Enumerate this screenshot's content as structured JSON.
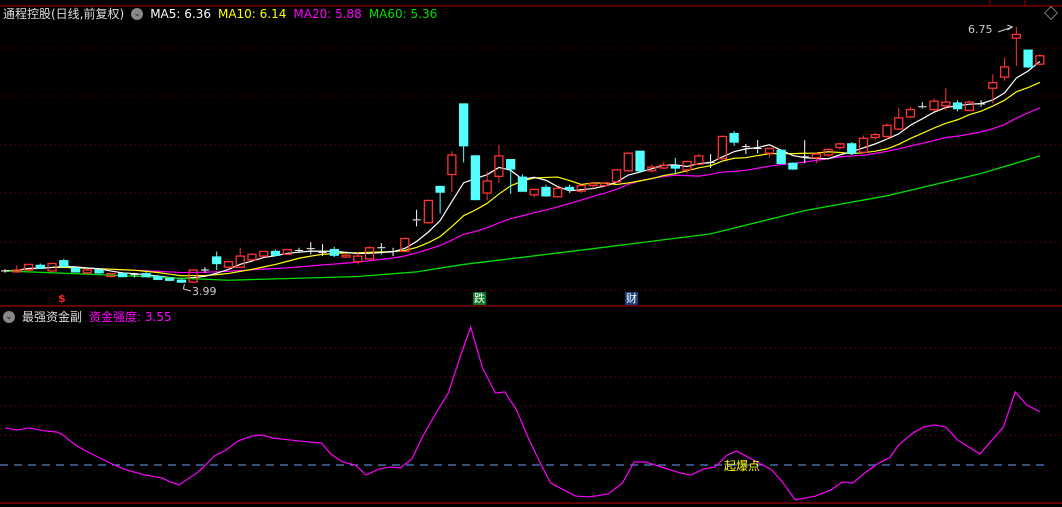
{
  "header": {
    "title": "通程控股(日线,前复权)",
    "ma5_label": "MA5: 6.36",
    "ma10_label": "MA10: 6.14",
    "ma20_label": "MA20: 5.88",
    "ma60_label": "MA60: 5.36"
  },
  "indicator_header": {
    "title": "最强资金副",
    "value_label": "资金强度: 3.55"
  },
  "annotations": {
    "high_label": "6.75",
    "low_label": "3.99",
    "trigger_label": "起爆点",
    "marker_dollar": "$",
    "marker_drop": "跌",
    "marker_finance": "财"
  },
  "colors": {
    "up": "#ff3232",
    "down": "#54ffff",
    "flat": "#ffffff",
    "ma5": "#ffffff",
    "ma10": "#ffff00",
    "ma20": "#ff00ff",
    "ma60": "#00e000",
    "indicator": "#ff00ff",
    "baseline": "#6f9fff",
    "grid": "#8b0000"
  },
  "chart_data": [
    {
      "type": "candlestick",
      "title": "通程控股(日线,前复权)",
      "price_range": [
        3.99,
        6.75
      ],
      "ohlc": [
        [
          4.12,
          4.14,
          4.1,
          4.12
        ],
        [
          4.11,
          4.18,
          4.1,
          4.13
        ],
        [
          4.13,
          4.2,
          4.12,
          4.19
        ],
        [
          4.18,
          4.2,
          4.14,
          4.15
        ],
        [
          4.12,
          4.21,
          4.11,
          4.2
        ],
        [
          4.23,
          4.25,
          4.16,
          4.17
        ],
        [
          4.15,
          4.16,
          4.11,
          4.11
        ],
        [
          4.1,
          4.14,
          4.09,
          4.13
        ],
        [
          4.13,
          4.14,
          4.09,
          4.1
        ],
        [
          4.06,
          4.1,
          4.05,
          4.09
        ],
        [
          4.09,
          4.11,
          4.05,
          4.06
        ],
        [
          4.08,
          4.1,
          4.05,
          4.08
        ],
        [
          4.09,
          4.11,
          4.05,
          4.06
        ],
        [
          4.06,
          4.08,
          4.02,
          4.03
        ],
        [
          4.04,
          4.05,
          4.01,
          4.02
        ],
        [
          4.02,
          4.03,
          3.99,
          4.0
        ],
        [
          4.0,
          4.14,
          3.99,
          4.13
        ],
        [
          4.13,
          4.16,
          4.1,
          4.13
        ],
        [
          4.27,
          4.33,
          4.13,
          4.2
        ],
        [
          4.16,
          4.23,
          4.15,
          4.22
        ],
        [
          4.16,
          4.37,
          4.15,
          4.28
        ],
        [
          4.24,
          4.31,
          4.23,
          4.3
        ],
        [
          4.28,
          4.34,
          4.27,
          4.33
        ],
        [
          4.33,
          4.35,
          4.28,
          4.29
        ],
        [
          4.3,
          4.36,
          4.29,
          4.35
        ],
        [
          4.34,
          4.37,
          4.32,
          4.34
        ],
        [
          4.36,
          4.43,
          4.3,
          4.36
        ],
        [
          4.32,
          4.41,
          4.28,
          4.32
        ],
        [
          4.35,
          4.38,
          4.27,
          4.29
        ],
        [
          4.27,
          4.3,
          4.26,
          4.29
        ],
        [
          4.22,
          4.32,
          4.19,
          4.28
        ],
        [
          4.25,
          4.39,
          4.24,
          4.37
        ],
        [
          4.37,
          4.42,
          4.3,
          4.36
        ],
        [
          4.33,
          4.37,
          4.28,
          4.33
        ],
        [
          4.33,
          4.48,
          4.32,
          4.47
        ],
        [
          4.67,
          4.78,
          4.6,
          4.66
        ],
        [
          4.64,
          4.89,
          4.63,
          4.88
        ],
        [
          5.03,
          5.04,
          4.74,
          4.97
        ],
        [
          5.16,
          5.41,
          4.97,
          5.37
        ],
        [
          5.92,
          5.92,
          5.29,
          5.47
        ],
        [
          5.36,
          5.36,
          4.9,
          4.89
        ],
        [
          4.96,
          5.19,
          4.88,
          5.09
        ],
        [
          5.14,
          5.48,
          5.07,
          5.36
        ],
        [
          5.32,
          5.32,
          4.95,
          5.22
        ],
        [
          5.13,
          5.16,
          4.98,
          4.98
        ],
        [
          4.94,
          5.0,
          4.91,
          5.0
        ],
        [
          5.02,
          5.05,
          4.92,
          4.93
        ],
        [
          4.92,
          5.01,
          4.91,
          5.01
        ],
        [
          5.02,
          5.05,
          4.96,
          5.0
        ],
        [
          4.98,
          5.05,
          4.96,
          5.04
        ],
        [
          5.04,
          5.07,
          5.01,
          5.06
        ],
        [
          5.04,
          5.08,
          5.02,
          5.07
        ],
        [
          5.08,
          5.21,
          5.07,
          5.21
        ],
        [
          5.2,
          5.4,
          5.19,
          5.39
        ],
        [
          5.41,
          5.41,
          5.19,
          5.2
        ],
        [
          5.2,
          5.27,
          5.18,
          5.24
        ],
        [
          5.23,
          5.29,
          5.22,
          5.26
        ],
        [
          5.25,
          5.34,
          5.16,
          5.23
        ],
        [
          5.21,
          5.31,
          5.17,
          5.3
        ],
        [
          5.27,
          5.38,
          5.26,
          5.36
        ],
        [
          5.28,
          5.38,
          5.23,
          5.29
        ],
        [
          5.33,
          5.58,
          5.32,
          5.57
        ],
        [
          5.6,
          5.63,
          5.47,
          5.51
        ],
        [
          5.46,
          5.49,
          5.38,
          5.45
        ],
        [
          5.44,
          5.53,
          5.39,
          5.43
        ],
        [
          5.39,
          5.45,
          5.34,
          5.44
        ],
        [
          5.42,
          5.43,
          5.27,
          5.28
        ],
        [
          5.28,
          5.29,
          5.21,
          5.22
        ],
        [
          5.35,
          5.53,
          5.28,
          5.34
        ],
        [
          5.34,
          5.4,
          5.28,
          5.38
        ],
        [
          5.37,
          5.44,
          5.35,
          5.43
        ],
        [
          5.45,
          5.5,
          5.43,
          5.49
        ],
        [
          5.49,
          5.51,
          5.37,
          5.39
        ],
        [
          5.4,
          5.58,
          5.39,
          5.55
        ],
        [
          5.56,
          5.61,
          5.53,
          5.59
        ],
        [
          5.57,
          5.71,
          5.53,
          5.69
        ],
        [
          5.65,
          5.88,
          5.64,
          5.77
        ],
        [
          5.78,
          5.89,
          5.77,
          5.86
        ],
        [
          5.88,
          5.94,
          5.87,
          5.89
        ],
        [
          5.86,
          5.98,
          5.84,
          5.95
        ],
        [
          5.9,
          6.09,
          5.85,
          5.94
        ],
        [
          5.93,
          5.96,
          5.84,
          5.87
        ],
        [
          5.85,
          5.96,
          5.84,
          5.94
        ],
        [
          5.91,
          5.96,
          5.89,
          5.92
        ],
        [
          6.09,
          6.24,
          5.93,
          6.15
        ],
        [
          6.21,
          6.42,
          6.17,
          6.32
        ],
        [
          6.63,
          6.75,
          6.33,
          6.67
        ],
        [
          6.5,
          6.5,
          6.31,
          6.32
        ],
        [
          6.35,
          6.46,
          6.34,
          6.44
        ]
      ],
      "ma60": [
        [
          0,
          4.12
        ],
        [
          8,
          4.08
        ],
        [
          19,
          4.02
        ],
        [
          30,
          4.06
        ],
        [
          35,
          4.11
        ],
        [
          39,
          4.19
        ],
        [
          50,
          4.36
        ],
        [
          60,
          4.52
        ],
        [
          68,
          4.77
        ],
        [
          75,
          4.93
        ],
        [
          83,
          5.17
        ],
        [
          88,
          5.36
        ]
      ],
      "high": {
        "index": 86,
        "value": 6.75
      },
      "low": {
        "index": 15,
        "value": 3.99
      },
      "markers": [
        {
          "index": 5,
          "key": "marker_dollar"
        },
        {
          "index": 40,
          "key": "marker_drop"
        },
        {
          "index": 53,
          "key": "marker_finance"
        }
      ]
    },
    {
      "type": "line",
      "title": "资金强度",
      "baseline": 0,
      "baseline_label": "起爆点",
      "last_value": 3.55,
      "points": [
        [
          0,
          2.47
        ],
        [
          1,
          2.33
        ],
        [
          2,
          2.47
        ],
        [
          3.4,
          2.27
        ],
        [
          4.4,
          2.2
        ],
        [
          4.8,
          2.07
        ],
        [
          6,
          1.33
        ],
        [
          7.2,
          0.8
        ],
        [
          9.3,
          0
        ],
        [
          10.1,
          -0.27
        ],
        [
          11.9,
          -0.67
        ],
        [
          13.4,
          -0.87
        ],
        [
          13.9,
          -1.07
        ],
        [
          14.8,
          -1.33
        ],
        [
          16.3,
          -0.53
        ],
        [
          16.8,
          -0.2
        ],
        [
          17.8,
          0.6
        ],
        [
          18.8,
          1.0
        ],
        [
          19.8,
          1.6
        ],
        [
          21,
          1.93
        ],
        [
          21.9,
          2.0
        ],
        [
          22.7,
          1.8
        ],
        [
          24.2,
          1.67
        ],
        [
          25.9,
          1.53
        ],
        [
          26.9,
          1.47
        ],
        [
          27.7,
          0.73
        ],
        [
          28.7,
          0.2
        ],
        [
          29.8,
          0
        ],
        [
          30.7,
          -0.67
        ],
        [
          31.8,
          -0.27
        ],
        [
          32.8,
          -0.13
        ],
        [
          33.6,
          -0.2
        ],
        [
          34.6,
          0.4
        ],
        [
          35.5,
          1.87
        ],
        [
          36.7,
          3.53
        ],
        [
          37.7,
          4.8
        ],
        [
          38.7,
          7.2
        ],
        [
          39.6,
          9.2
        ],
        [
          40.6,
          6.47
        ],
        [
          41.7,
          4.8
        ],
        [
          42.5,
          4.87
        ],
        [
          43.5,
          3.67
        ],
        [
          44.5,
          1.8
        ],
        [
          45.6,
          0
        ],
        [
          46.4,
          -1.2
        ],
        [
          48.5,
          -2.07
        ],
        [
          49.7,
          -2.13
        ],
        [
          51.3,
          -1.93
        ],
        [
          52.5,
          -1.2
        ],
        [
          53.5,
          0.2
        ],
        [
          54.5,
          0.2
        ],
        [
          55.8,
          -0.13
        ],
        [
          57.4,
          -0.53
        ],
        [
          58.3,
          -0.67
        ],
        [
          59.4,
          -0.27
        ],
        [
          60.4,
          -0.13
        ],
        [
          61.4,
          0.67
        ],
        [
          62.2,
          0.93
        ],
        [
          63.3,
          0.47
        ],
        [
          65.2,
          -0.33
        ],
        [
          66.1,
          -1.13
        ],
        [
          67.2,
          -2.33
        ],
        [
          68.9,
          -2.07
        ],
        [
          70.2,
          -1.67
        ],
        [
          71.2,
          -1.13
        ],
        [
          72.1,
          -1.2
        ],
        [
          73.1,
          -0.53
        ],
        [
          74.3,
          0.13
        ],
        [
          75.2,
          0.47
        ],
        [
          76,
          1.33
        ],
        [
          77.2,
          2.13
        ],
        [
          78.1,
          2.53
        ],
        [
          79,
          2.67
        ],
        [
          80,
          2.53
        ],
        [
          81,
          1.67
        ],
        [
          82.9,
          0.73
        ],
        [
          84.9,
          2.53
        ],
        [
          85.9,
          4.87
        ],
        [
          86.9,
          4.0
        ],
        [
          88,
          3.55
        ]
      ]
    }
  ]
}
